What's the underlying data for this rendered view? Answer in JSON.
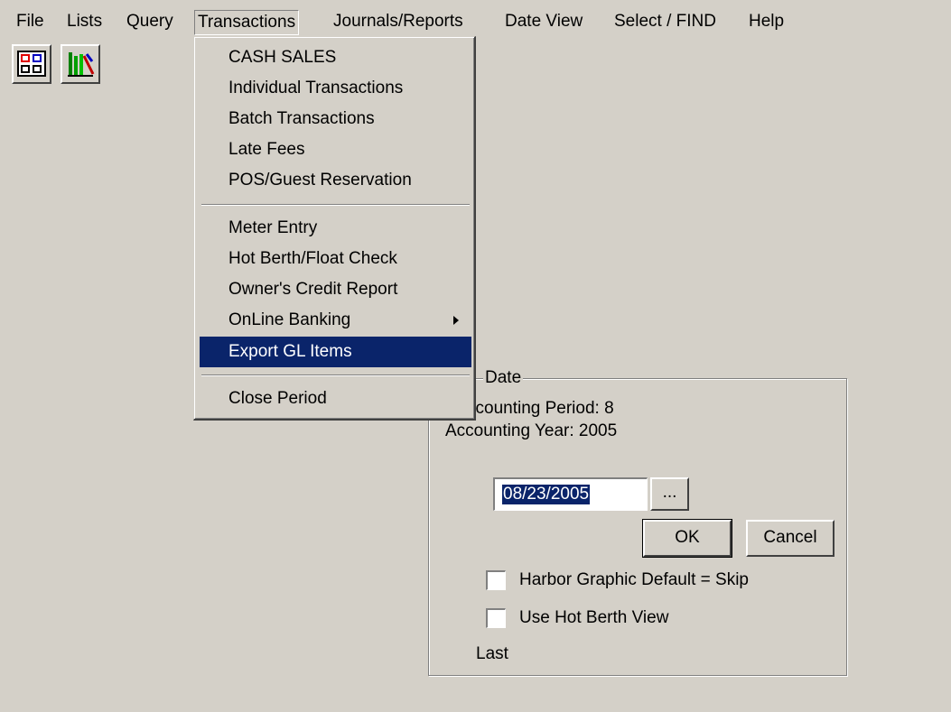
{
  "menubar": {
    "items": [
      {
        "label": "File"
      },
      {
        "label": "Lists"
      },
      {
        "label": "Query"
      },
      {
        "label": "Transactions"
      },
      {
        "label": "Journals/Reports"
      },
      {
        "label": "Date View"
      },
      {
        "label": "Select / FIND"
      },
      {
        "label": "Help"
      }
    ],
    "open_item": "Transactions"
  },
  "toolbar": {
    "buttons": [
      {
        "icon": "calendar-grid-icon"
      },
      {
        "icon": "chart-bars-icon"
      }
    ]
  },
  "transactions_menu": {
    "items": [
      {
        "label": "CASH SALES"
      },
      {
        "label": "Individual Transactions"
      },
      {
        "label": "Batch Transactions"
      },
      {
        "label": "Late Fees"
      },
      {
        "label": "POS/Guest Reservation"
      },
      {
        "label": "Meter Entry"
      },
      {
        "label": "Hot Berth/Float Check"
      },
      {
        "label": "Owner's Credit Report"
      },
      {
        "label": "OnLine Banking",
        "submenu": true
      },
      {
        "label": "Export GL Items",
        "selected": true
      },
      {
        "label": "Close Period"
      }
    ]
  },
  "date_panel": {
    "title": "Date",
    "period_label": "ccounting Period: 8",
    "year_label": "Accounting Year: 2005",
    "date_value": "08/23/2005",
    "browse_label": "...",
    "ok_label": "OK",
    "cancel_label": "Cancel",
    "harbor_checkbox_label": "Harbor Graphic Default = Skip",
    "harbor_checked": false,
    "hotberth_checkbox_label": "Use Hot Berth View",
    "hotberth_checked": false,
    "last_label": "Last"
  },
  "colors": {
    "face": "#d4d0c8",
    "highlight": "#0a246a"
  }
}
